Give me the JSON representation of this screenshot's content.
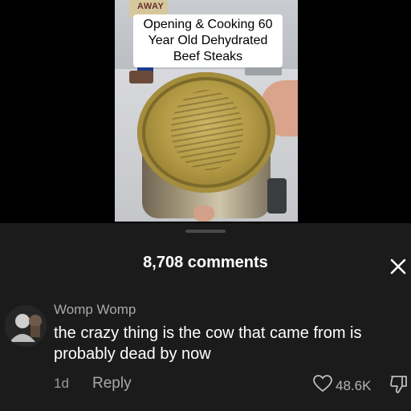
{
  "video": {
    "caption_lines": [
      "Opening & Cooking 60",
      "Year Old Dehydrated",
      "Beef Steaks"
    ],
    "background_text": "AWAY"
  },
  "comments": {
    "count_label": "8,708 comments",
    "items": [
      {
        "author": "Womp Womp",
        "text": "the crazy thing is the cow that came from is probably dead by now",
        "time": "1d",
        "reply_label": "Reply",
        "likes": "48.6K"
      }
    ]
  },
  "icons": {
    "close": "close-icon",
    "like": "heart-icon",
    "dislike": "thumbs-down-icon"
  }
}
